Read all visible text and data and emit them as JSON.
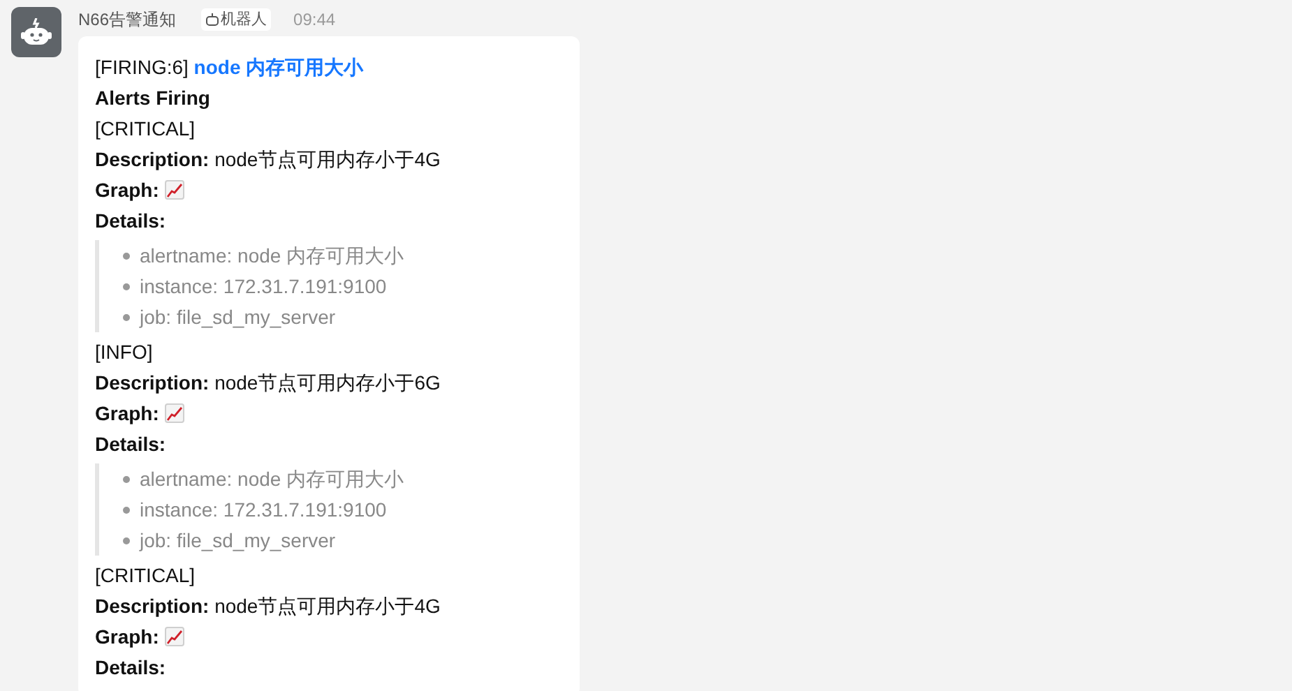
{
  "message": {
    "sender": "N66告警通知",
    "badge": "机器人",
    "time": "09:44",
    "title_prefix": "[FIRING:6]",
    "title_link": "node 内存可用大小",
    "heading": "Alerts Firing",
    "alerts": [
      {
        "severity": "[CRITICAL]",
        "description": "**Description:** node节点可用内存小于4G",
        "graph_label": "Graph:",
        "details_label": "Details:",
        "details": [
          "alertname: node 内存可用大小",
          "instance: 172.31.7.191:9100",
          "job: file_sd_my_server"
        ]
      },
      {
        "severity": "[INFO]",
        "description": "**Description:** node节点可用内存小于6G",
        "graph_label": "Graph:",
        "details_label": "Details:",
        "details": [
          "alertname: node 内存可用大小",
          "instance: 172.31.7.191:9100",
          "job: file_sd_my_server"
        ]
      },
      {
        "severity": "[CRITICAL]",
        "description": "**Description:** node节点可用内存小于4G",
        "graph_label": "Graph:",
        "details_label": "Details:"
      }
    ]
  }
}
